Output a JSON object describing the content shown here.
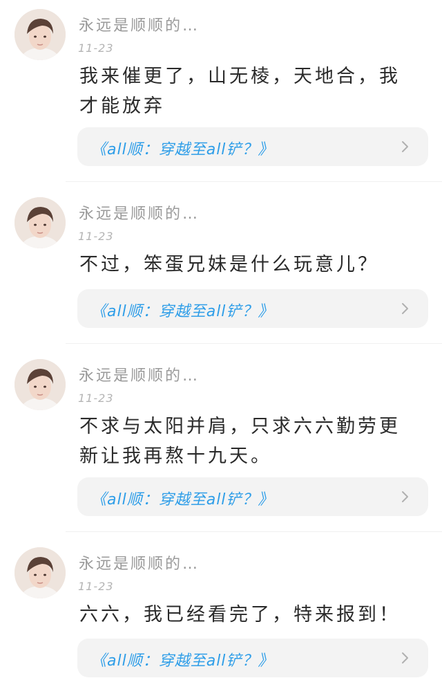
{
  "comments": [
    {
      "username": "永远是顺顺的…",
      "date": "11-23",
      "text": "我来催更了，山无棱，天地合，我才能放弃",
      "link_title": "《all顺：穿越至all铲？》"
    },
    {
      "username": "永远是顺顺的…",
      "date": "11-23",
      "text": "不过，笨蛋兄妹是什么玩意儿？",
      "link_title": "《all顺：穿越至all铲？》"
    },
    {
      "username": "永远是顺顺的…",
      "date": "11-23",
      "text": "不求与太阳并肩，只求六六勤劳更新让我再熬十九天。",
      "link_title": "《all顺：穿越至all铲？》"
    },
    {
      "username": "永远是顺顺的…",
      "date": "11-23",
      "text": "六六，我已经看完了，特来报到！",
      "link_title": "《all顺：穿越至all铲？》"
    }
  ],
  "icons": {
    "avatar": "avatar-photo",
    "chevron": "chevron-right-icon"
  },
  "colors": {
    "link": "#2f9ee8",
    "card_bg": "#f3f3f3",
    "username": "#9a9a9a",
    "text": "#2a2a2a"
  }
}
